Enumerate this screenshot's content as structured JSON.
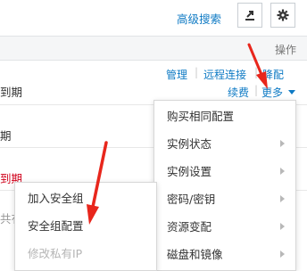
{
  "toolbar": {
    "advanced_search": "高级搜索",
    "export_icon": "export-icon",
    "settings_icon": "gear-icon"
  },
  "table": {
    "operation_header": "操作",
    "rows": [
      {
        "text": "到期",
        "color": "#333333"
      },
      {
        "text": "期",
        "color": "#333333"
      },
      {
        "text": "到期",
        "color": "#d0021b"
      },
      {
        "text": "共有",
        "color": "#999999"
      }
    ],
    "actions": {
      "manage": "管理",
      "remote_connect": "远程连接",
      "downgrade": "降配",
      "renew": "续费",
      "more": "更多"
    }
  },
  "more_menu": {
    "items": [
      {
        "label": "购买相同配置",
        "has_submenu": false
      },
      {
        "label": "实例状态",
        "has_submenu": true
      },
      {
        "label": "实例设置",
        "has_submenu": true
      },
      {
        "label": "密码/密钥",
        "has_submenu": true
      },
      {
        "label": "资源变配",
        "has_submenu": true
      },
      {
        "label": "磁盘和镜像",
        "has_submenu": true
      }
    ]
  },
  "security_submenu": {
    "items": [
      {
        "label": "加入安全组",
        "disabled": false
      },
      {
        "label": "安全组配置",
        "disabled": false
      },
      {
        "label": "修改私有IP",
        "disabled": true
      }
    ]
  },
  "colors": {
    "link": "#0e7ac4",
    "annotation_arrow": "#e8261c"
  }
}
